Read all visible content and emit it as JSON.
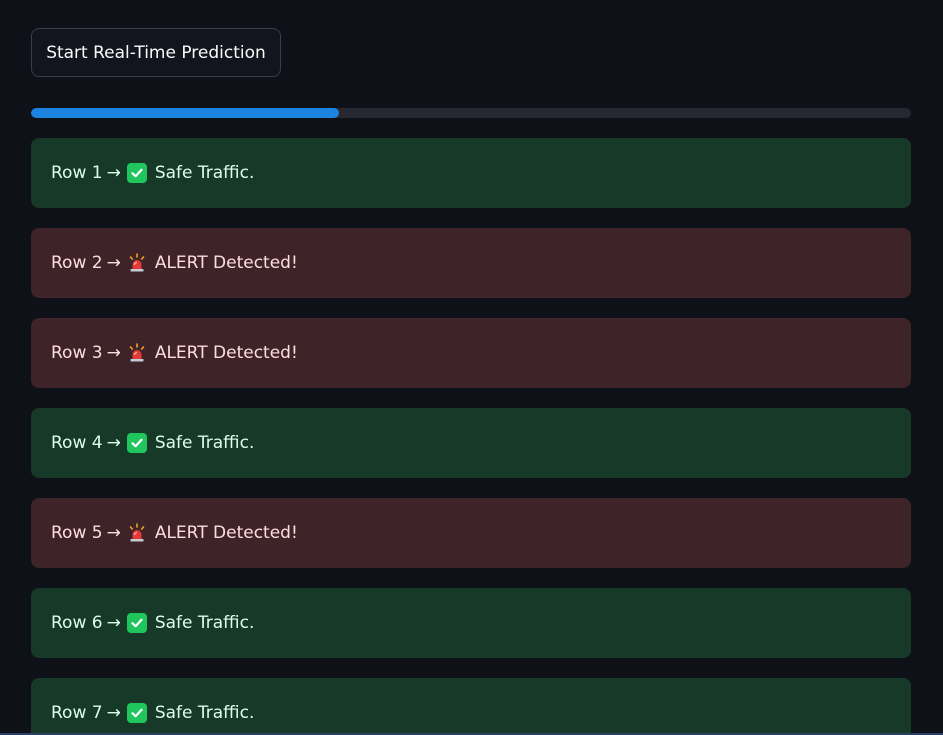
{
  "toolbar": {
    "start_button_label": "Start Real-Time Prediction"
  },
  "progress": {
    "value_percent": 35,
    "fill_color": "#1c83e1",
    "track_color": "#262730"
  },
  "colors": {
    "background": "#0e1117",
    "safe_bg": "#173928",
    "safe_text": "#dffde9",
    "alert_bg": "#3e2328",
    "alert_text": "#ffdede",
    "check_green": "#21c55d"
  },
  "rows": [
    {
      "label": "Row 1",
      "arrow": "→",
      "status": "safe",
      "icon": "check-mark-icon",
      "message": "Safe Traffic."
    },
    {
      "label": "Row 2",
      "arrow": "→",
      "status": "alert",
      "icon": "police-light-icon",
      "message": "ALERT Detected!"
    },
    {
      "label": "Row 3",
      "arrow": "→",
      "status": "alert",
      "icon": "police-light-icon",
      "message": "ALERT Detected!"
    },
    {
      "label": "Row 4",
      "arrow": "→",
      "status": "safe",
      "icon": "check-mark-icon",
      "message": "Safe Traffic."
    },
    {
      "label": "Row 5",
      "arrow": "→",
      "status": "alert",
      "icon": "police-light-icon",
      "message": "ALERT Detected!"
    },
    {
      "label": "Row 6",
      "arrow": "→",
      "status": "safe",
      "icon": "check-mark-icon",
      "message": "Safe Traffic."
    },
    {
      "label": "Row 7",
      "arrow": "→",
      "status": "safe",
      "icon": "check-mark-icon",
      "message": "Safe Traffic."
    }
  ]
}
